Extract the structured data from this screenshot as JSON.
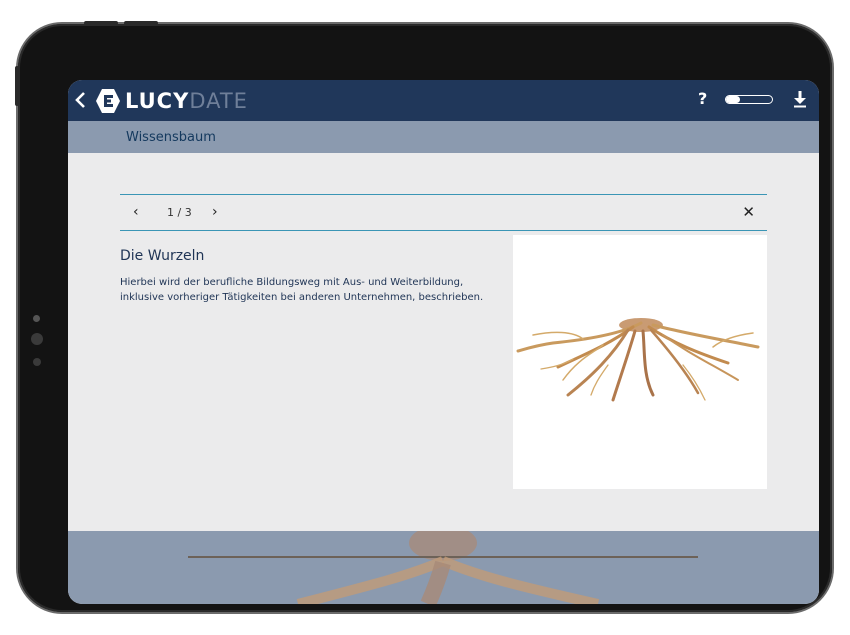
{
  "app": {
    "logo_text_bold": "LUCY",
    "logo_text_light": "DATE",
    "help_label": "?"
  },
  "breadcrumb": {
    "label": "Wissensbaum"
  },
  "pager": {
    "prev_label": "‹",
    "position": "1 / 3",
    "next_label": "›",
    "close_label": "✕"
  },
  "content": {
    "title": "Die Wurzeln",
    "description": "Hierbei wird der berufliche Bildungsweg mit Aus- und Weiterbildung, inklusive vorheriger Tätigkeiten bei anderen Unternehmen, beschrieben."
  },
  "colors": {
    "topbar": "#20375a",
    "crumbbar": "#8b9aaf",
    "accent_line": "#3a95b5",
    "text": "#1f3455"
  },
  "icons": [
    "back-chevron-icon",
    "logo-icon",
    "help-icon",
    "toggle-switch",
    "download-icon",
    "close-icon"
  ]
}
